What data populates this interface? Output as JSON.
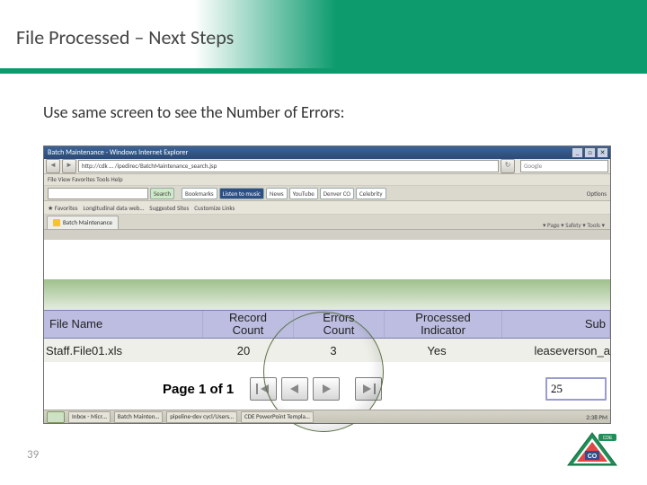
{
  "slide": {
    "title": "File Processed – Next Steps",
    "subtitle": "Use same screen to see the Number of Errors:",
    "page_number": "39"
  },
  "browser": {
    "window_title": "Batch Maintenance - Windows Internet Explorer",
    "url": "http://cdk … /ipedirec/BatchMaintenance_search.jsp",
    "search_placeholder": "Google",
    "menubar": "File   View   Favorites   Tools   Help",
    "toolbar": {
      "search": "Search",
      "bookmarks": "Bookmarks",
      "listen": "Listen to music",
      "news": "News",
      "youtube": "YouTube",
      "denver": "Denver CO",
      "celebrity": "Celebrity",
      "options": "Options"
    },
    "favbar": {
      "favorites": "Favorites",
      "entry1": "Longitudinal data web…",
      "entry2": "Suggested Sites",
      "entry3": "Customize Links"
    },
    "tabbar": {
      "active_tab": "Batch Maintenance",
      "util": "▾    Page ▾   Safety ▾   Tools ▾"
    }
  },
  "table": {
    "headers": {
      "file_name": "File Name",
      "record_count_l1": "Record",
      "record_count_l2": "Count",
      "errors_count_l1": "Errors",
      "errors_count_l2": "Count",
      "processed_l1": "Processed",
      "processed_l2": "Indicator",
      "submitter": "Sub"
    },
    "row": {
      "file_name": "Staff.File01.xls",
      "record_count": "20",
      "errors_count": "3",
      "processed": "Yes",
      "submitter": "leaseverson_a"
    },
    "pager_label": "Page 1 of 1",
    "page_size": "25"
  },
  "taskbar": {
    "items": [
      "Inbox - Micr…",
      "Batch Mainten…",
      "pipeline-dev cycl/Users…",
      "CDE PowerPoint Templa…"
    ],
    "clock": "2:38 PM"
  },
  "logo": {
    "badge": "CDE",
    "co": "CO"
  }
}
